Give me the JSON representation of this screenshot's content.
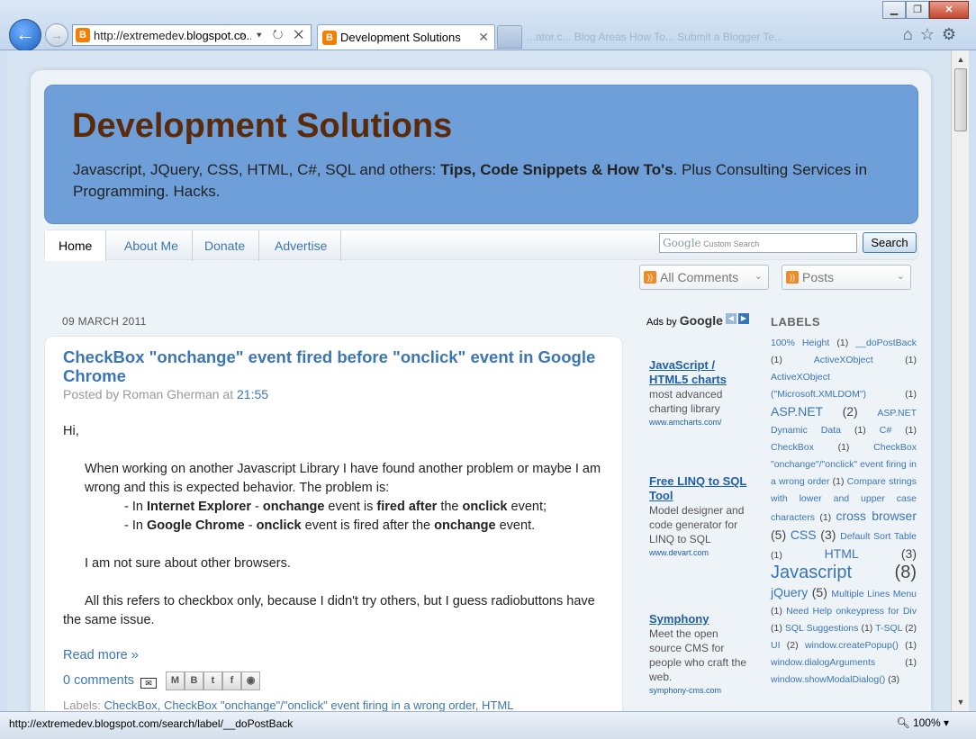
{
  "browser": {
    "address_url_prefix": "http://extremedev.",
    "address_url_host": "blogspot.co...",
    "address_icons": "⌕ ▾ ↻ ✕",
    "tab_title": "Development Solutions",
    "tab_close": "✕",
    "ghost_tabs": "...ator.c...   Blog Areas How To...   Submit a Blogger Te...",
    "status_url": "http://extremedev.blogspot.com/search/label/__doPostBack",
    "zoom": "100%"
  },
  "blog": {
    "title": "Development Solutions",
    "desc_pre": "Javascript, JQuery, CSS, HTML, C#, SQL and others: ",
    "desc_bold": "Tips, Code Snippets & How To's",
    "desc_post": ". Plus Consulting Services in Programming. Hacks."
  },
  "nav": {
    "tabs": [
      "Home",
      "About Me",
      "Donate",
      "Advertise"
    ],
    "search_placeholder": "Custom Search",
    "search_google": "Google",
    "search_button": "Search"
  },
  "feeds": {
    "comments_label": "All Comments",
    "posts_label": "Posts"
  },
  "post": {
    "date": "09 MARCH 2011",
    "title": "CheckBox \"onchange\" event fired before \"onclick\" event in Google Chrome",
    "byline_prefix": "Posted by Roman Gherman at ",
    "byline_time": "21:55",
    "greeting": "Hi,",
    "para1": "When working on another Javascript Library I have found another problem or maybe I am wrong and this is expected behavior. The problem is:",
    "bullet1": {
      "a": "- In ",
      "b": "Internet Explorer",
      "c": " - ",
      "d": "onchange",
      "e": " event is ",
      "f": "fired after",
      "g": " the ",
      "h": "onclick",
      "i": " event;"
    },
    "bullet2": {
      "a": "- In ",
      "b": "Google Chrome",
      "c": " - ",
      "d": "onclick",
      "e": " event is fired after the ",
      "f": "onchange",
      "g": " event."
    },
    "para2": "I am not sure about other browsers.",
    "para3": "All this refers to checkbox only, because I didn't try others, but I guess radiobuttons have the same issue.",
    "read_more": "Read more »",
    "comments": "0 comments",
    "labels_prefix": "Labels: ",
    "labels_links": "CheckBox, CheckBox \"onchange\"/\"onclick\" event firing in a wrong order, HTML"
  },
  "ads": {
    "header_prefix": "Ads by ",
    "header_google": "Google",
    "items": [
      {
        "title": "JavaScript / HTML5 charts",
        "text": "most advanced charting library",
        "url": "www.amcharts.com/"
      },
      {
        "title": "Free LINQ to SQL Tool",
        "text": "Model designer and code generator for LINQ to SQL",
        "url": "www.devart.com"
      },
      {
        "title": "Symphony",
        "text": "Meet the open source CMS for people who craft the web.",
        "url": "symphony-cms.com"
      }
    ]
  },
  "labels": {
    "title": "LABELS",
    "items": [
      {
        "name": "100% Height",
        "count": "(1)",
        "size": 1
      },
      {
        "name": "__doPostBack",
        "count": "(1)",
        "size": 1
      },
      {
        "name": "ActiveXObject",
        "count": "(1)",
        "size": 1
      },
      {
        "name": "ActiveXObject (\"Microsoft.XMLDOM\")",
        "count": "(1)",
        "size": 1
      },
      {
        "name": "ASP.NET",
        "count": "(2)",
        "size": 2
      },
      {
        "name": "ASP.NET Dynamic Data",
        "count": "(1)",
        "size": 1
      },
      {
        "name": "C#",
        "count": "(1)",
        "size": 1
      },
      {
        "name": "CheckBox",
        "count": "(1)",
        "size": 1
      },
      {
        "name": "CheckBox \"onchange\"/\"onclick\" event firing in a wrong order",
        "count": "(1)",
        "size": 1
      },
      {
        "name": "Compare strings with lower and upper case characters",
        "count": "(1)",
        "size": 1
      },
      {
        "name": "cross browser",
        "count": "(5)",
        "size": 2
      },
      {
        "name": "CSS",
        "count": "(3)",
        "size": 2
      },
      {
        "name": "Default Sort Table",
        "count": "(1)",
        "size": 1
      },
      {
        "name": "HTML",
        "count": "(3)",
        "size": 2
      },
      {
        "name": "Javascript",
        "count": "(8)",
        "size": 3
      },
      {
        "name": "jQuery",
        "count": "(5)",
        "size": 2
      },
      {
        "name": "Multiple Lines Menu",
        "count": "(1)",
        "size": 1
      },
      {
        "name": "Need Help onkeypress for Div",
        "count": "(1)",
        "size": 1
      },
      {
        "name": "SQL Suggestions",
        "count": "(1)",
        "size": 1
      },
      {
        "name": "T-SQL",
        "count": "(2)",
        "size": 1
      },
      {
        "name": "UI",
        "count": "(2)",
        "size": 1
      },
      {
        "name": "window.createPopup()",
        "count": "(1)",
        "size": 1
      },
      {
        "name": "window.dialogArguments",
        "count": "(1)",
        "size": 1
      },
      {
        "name": "window.showModalDialog()",
        "count": "(3)",
        "size": 1
      }
    ]
  }
}
